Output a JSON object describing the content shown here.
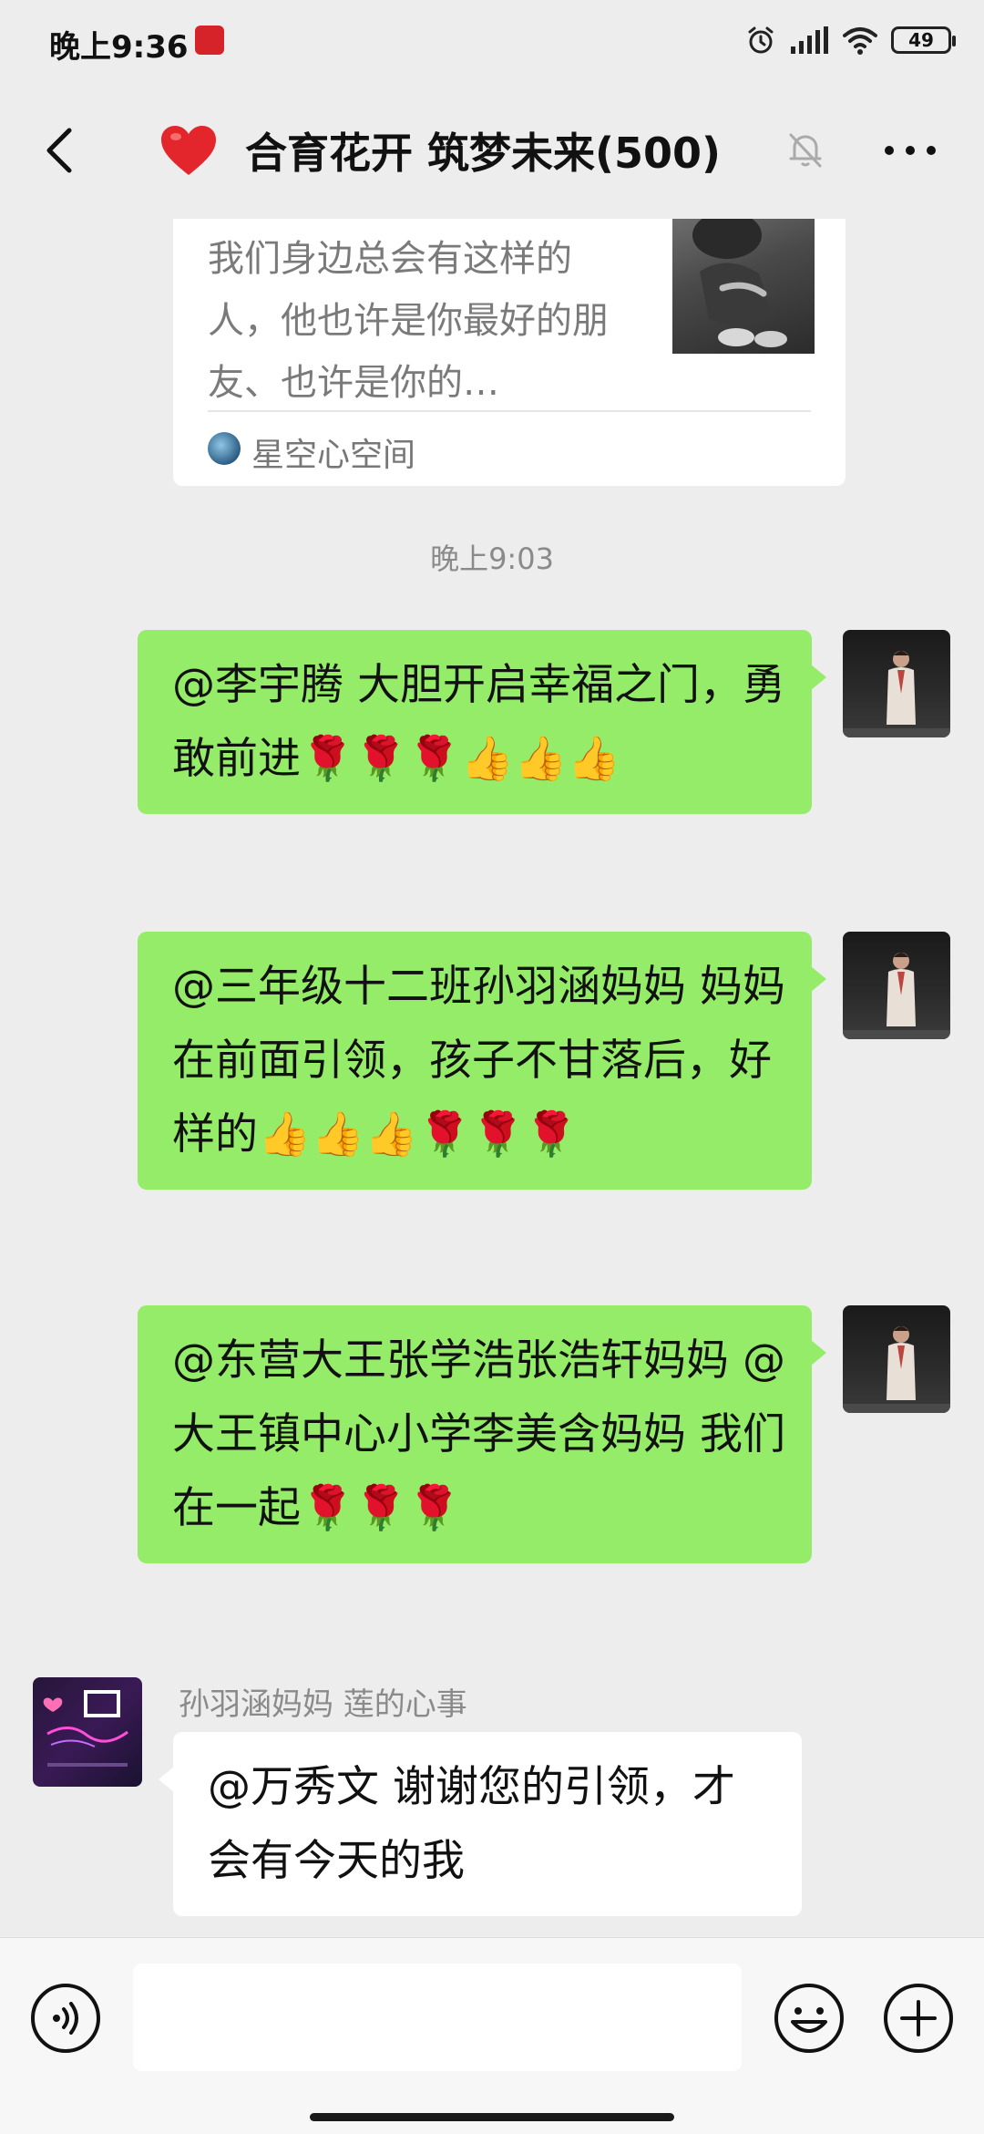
{
  "status_bar": {
    "time": "晚上9:36",
    "battery": "49"
  },
  "header": {
    "title": "合育花开 筑梦未来(500)"
  },
  "share_card": {
    "description": "我们身边总会有这样的人，他也许是你最好的朋友、也许是你的…",
    "source_name": "星空心空间"
  },
  "timestamp": "晚上9:03",
  "messages": [
    {
      "side": "self",
      "text": "@李宇腾  大胆开启幸福之门，勇敢前进🌹🌹🌹👍👍👍"
    },
    {
      "side": "self",
      "text": "@三年级十二班孙羽涵妈妈  妈妈在前面引领，孩子不甘落后，好样的👍👍👍🌹🌹🌹"
    },
    {
      "side": "self",
      "text": "@东营大王张学浩张浩轩妈妈  @大王镇中心小学李美含妈妈  我们在一起🌹🌹🌹"
    },
    {
      "side": "other",
      "sender": "孙羽涵妈妈  莲的心事",
      "text": "@万秀文  谢谢您的引领，才会有今天的我"
    }
  ],
  "input": {
    "value": ""
  },
  "colors": {
    "background": "#ededed",
    "self_bubble": "#95ec69",
    "other_bubble": "#ffffff",
    "heart": "#e3262b"
  }
}
